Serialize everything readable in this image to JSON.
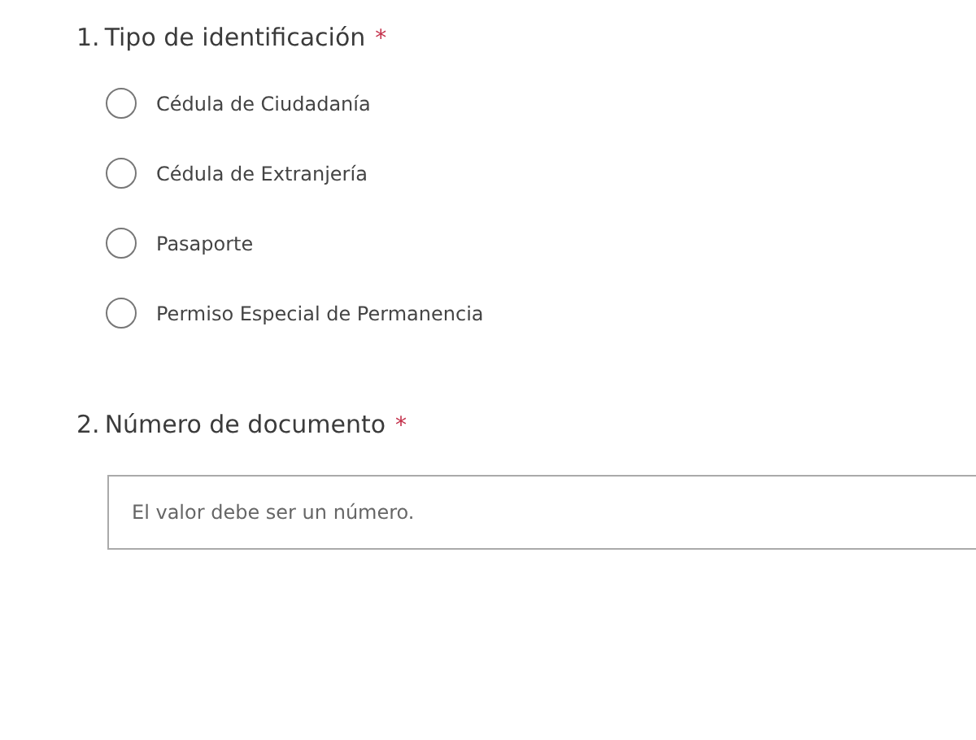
{
  "questions": [
    {
      "kind": "choice",
      "number": "1.",
      "title": "Tipo de identificación",
      "required_mark": "*",
      "options": [
        {
          "label": "Cédula de Ciudadanía",
          "selected": false
        },
        {
          "label": "Cédula de Extranjería",
          "selected": false
        },
        {
          "label": "Pasaporte",
          "selected": false
        },
        {
          "label": "Permiso Especial de Permanencia",
          "selected": false
        }
      ]
    },
    {
      "kind": "text",
      "number": "2.",
      "title": "Número de documento",
      "required_mark": "*",
      "placeholder": "El valor debe ser un número."
    }
  ]
}
